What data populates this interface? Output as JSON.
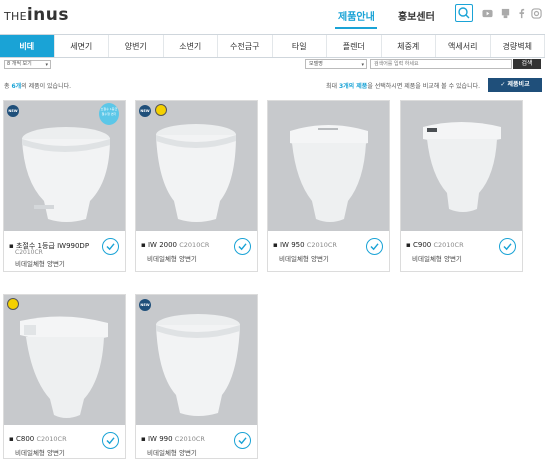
{
  "header": {
    "logo_prefix": "THE",
    "logo_main": "inus",
    "nav": [
      "제품안내",
      "홍보센터"
    ]
  },
  "tabs": [
    "비데",
    "세면기",
    "양변기",
    "소변기",
    "수전금구",
    "타일",
    "플렌더",
    "체중계",
    "액세서리",
    "경량벽체"
  ],
  "filters": {
    "sort_label": "8 개씩 보기",
    "field_label": "모델명",
    "search_placeholder": "검색어를 입력 하세요",
    "search_button": "검색"
  },
  "summary": {
    "count_pre": "총 ",
    "count_num": "6개",
    "count_post": "의 제품이 있습니다.",
    "compare_pre": "최대 ",
    "compare_num": "3개의 제품",
    "compare_post": "을 선택하시면 제품을 비교해 볼 수 있습니다.",
    "compare_button": "제품비교"
  },
  "products": [
    {
      "name": "초절수 1등급 IW990DP",
      "code": "C2010CR",
      "desc": "비데일체형 양변기",
      "promo": "초절수 1등급 절수형 변기"
    },
    {
      "name": "IW 2000",
      "code": "C2010CR",
      "desc": "비데일체형 양변기"
    },
    {
      "name": "IW 950",
      "code": "C2010CR",
      "desc": "비데일체형 양변기"
    },
    {
      "name": "C900",
      "code": "C2010CR",
      "desc": "비데일체형 양변기"
    },
    {
      "name": "C800",
      "code": "C2010CR",
      "desc": "비데일체형 양변기"
    },
    {
      "name": "IW 990",
      "code": "C2010CR",
      "desc": "비데일체형 양변기"
    }
  ],
  "colors": {
    "accent": "#1aa3d6",
    "navy": "#1f4f7a",
    "card_bg": "#c7c9cc"
  },
  "icons": [
    "search-icon",
    "youtube-icon",
    "blog-icon",
    "facebook-icon",
    "instagram-icon",
    "check-icon"
  ]
}
